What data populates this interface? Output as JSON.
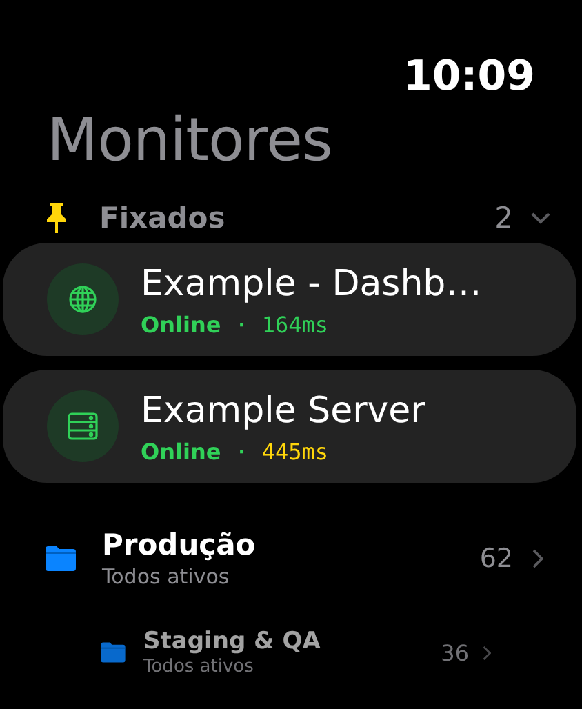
{
  "status_bar": {
    "time": "10:09"
  },
  "title": "Monitores",
  "pinned": {
    "label": "Fixados",
    "count": "2",
    "expanded": true
  },
  "monitors": [
    {
      "name": "Example - Dashb…",
      "kind": "globe",
      "status": "Online",
      "separator": "·",
      "latency": "164ms",
      "color": "#30d158"
    },
    {
      "name": "Example Server",
      "kind": "server",
      "status": "Online",
      "separator": "·",
      "latency": "445ms",
      "color": "#ffd60a"
    }
  ],
  "groups": [
    {
      "name": "Produção",
      "subtitle": "Todos ativos",
      "count": "62"
    },
    {
      "name": "Staging & QA",
      "subtitle": "Todos ativos",
      "count": "36"
    }
  ]
}
